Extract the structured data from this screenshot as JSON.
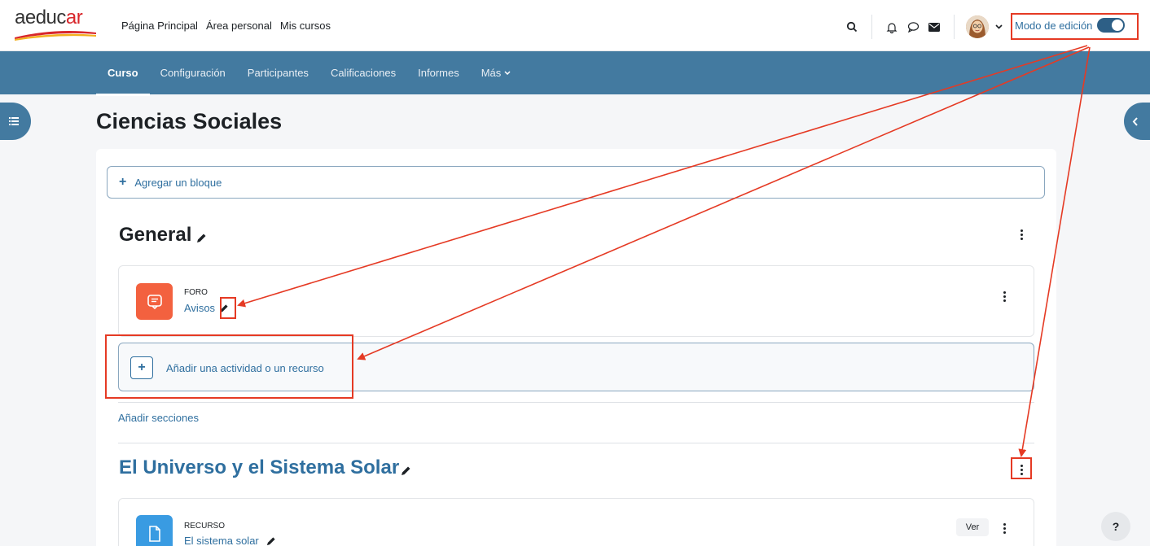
{
  "brand": {
    "logo_text_main": "aeduc",
    "logo_text_accent": "ar"
  },
  "topnav": {
    "items": [
      "Página Principal",
      "Área personal",
      "Mis cursos"
    ]
  },
  "header_right": {
    "edit_mode_label": "Modo de edición",
    "edit_mode_on": true
  },
  "icons": {
    "search": "search-icon",
    "bell": "bell-icon",
    "chat": "chat-bubble-icon",
    "mail": "envelope-icon",
    "user_menu": "chevron-down-icon"
  },
  "secnav": {
    "items": [
      "Curso",
      "Configuración",
      "Participantes",
      "Calificaciones",
      "Informes",
      "Más"
    ],
    "active": "Curso"
  },
  "course": {
    "title": "Ciencias Sociales"
  },
  "add_block": {
    "label": "Agregar un bloque"
  },
  "sections": [
    {
      "title": "General",
      "activities": [
        {
          "type": "FORO",
          "name": "Avisos"
        }
      ],
      "add_activity_label": "Añadir una actividad o un recurso"
    },
    {
      "title": "El Universo y el Sistema Solar",
      "activities": [
        {
          "type": "RECURSO",
          "name": "El sistema solar",
          "view_label": "Ver"
        }
      ]
    }
  ],
  "add_sections_label": "Añadir secciones",
  "help": {
    "label": "?"
  },
  "colors": {
    "primary": "#437aa0",
    "link": "#2f6f9f",
    "annotation": "#e53a24",
    "forum_icon_bg": "#f3613f",
    "resource_icon_bg": "#399be2"
  }
}
